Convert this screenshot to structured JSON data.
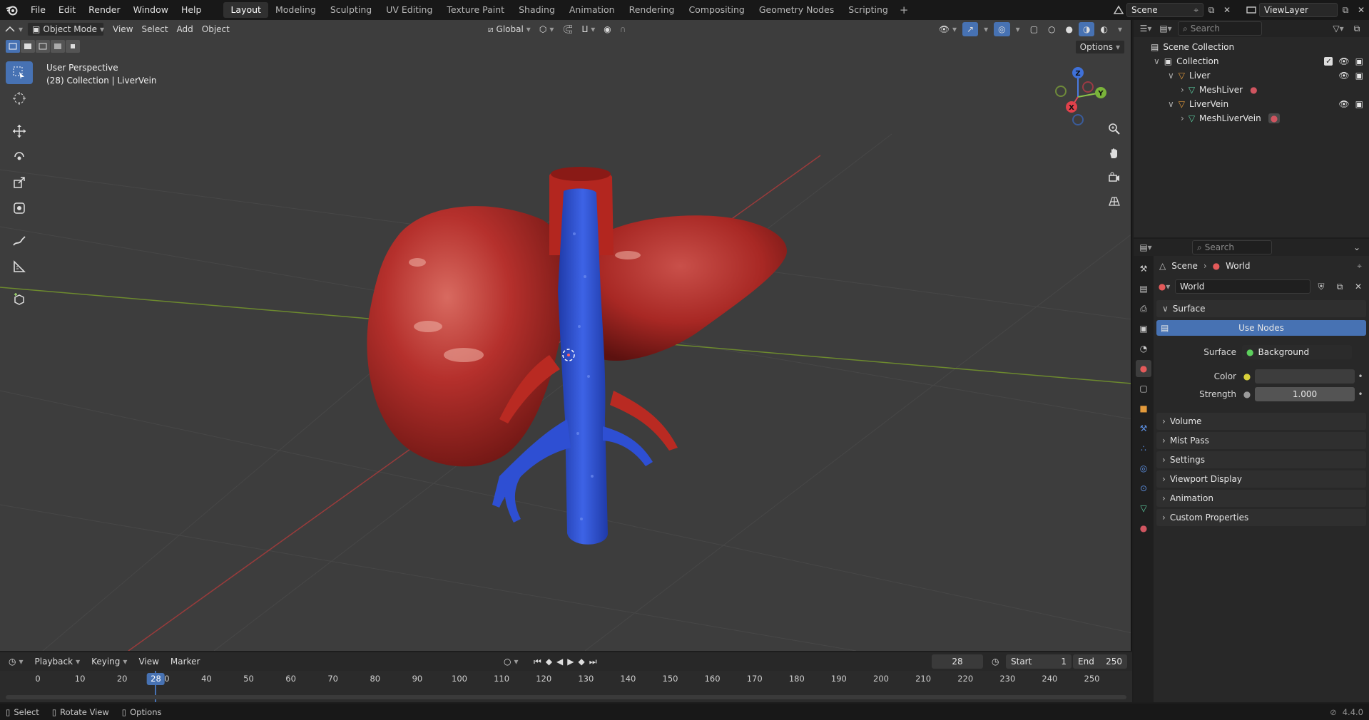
{
  "topbar": {
    "menus": [
      "File",
      "Edit",
      "Render",
      "Window",
      "Help"
    ],
    "workspaces": [
      "Layout",
      "Modeling",
      "Sculpting",
      "UV Editing",
      "Texture Paint",
      "Shading",
      "Animation",
      "Rendering",
      "Compositing",
      "Geometry Nodes",
      "Scripting"
    ],
    "active_workspace": "Layout",
    "scene_name": "Scene",
    "view_layer": "ViewLayer"
  },
  "viewport": {
    "mode": "Object Mode",
    "menus": [
      "View",
      "Select",
      "Add",
      "Object"
    ],
    "transform_orientation": "Global",
    "options_label": "Options",
    "overlay_line1": "User Perspective",
    "overlay_line2": "(28) Collection | LiverVein",
    "gizmo_axes": {
      "x": "X",
      "y": "Y",
      "z": "Z"
    },
    "colors": {
      "background": "#3d3d3d",
      "x_axis": "#9a3b3b",
      "y_axis": "#6d8a2e",
      "accent": "#4772b3",
      "liver": "#b5302c",
      "vein": "#2d4fd0"
    }
  },
  "outliner": {
    "search_placeholder": "Search",
    "root": "Scene Collection",
    "collection": "Collection",
    "items": [
      {
        "name": "Liver",
        "mesh": "MeshLiver"
      },
      {
        "name": "LiverVein",
        "mesh": "MeshLiverVein"
      }
    ]
  },
  "properties": {
    "search_placeholder": "Search",
    "breadcrumb": [
      "Scene",
      "World"
    ],
    "world_name": "World",
    "surface_panel": "Surface",
    "use_nodes_label": "Use Nodes",
    "surface_label": "Surface",
    "surface_value": "Background",
    "color_label": "Color",
    "strength_label": "Strength",
    "strength_value": "1.000",
    "panels": [
      "Volume",
      "Mist Pass",
      "Settings",
      "Viewport Display",
      "Animation",
      "Custom Properties"
    ]
  },
  "timeline": {
    "menus": [
      "Playback",
      "Keying",
      "View",
      "Marker"
    ],
    "current_frame": "28",
    "start_label": "Start",
    "start_value": "1",
    "end_label": "End",
    "end_value": "250",
    "ticks": [
      "0",
      "10",
      "20",
      "30",
      "40",
      "50",
      "60",
      "70",
      "80",
      "90",
      "100",
      "110",
      "120",
      "130",
      "140",
      "150",
      "160",
      "170",
      "180",
      "190",
      "200",
      "210",
      "220",
      "230",
      "240",
      "250"
    ]
  },
  "statusbar": {
    "items": [
      "Select",
      "Rotate View",
      "Options"
    ],
    "version": "4.4.0"
  }
}
